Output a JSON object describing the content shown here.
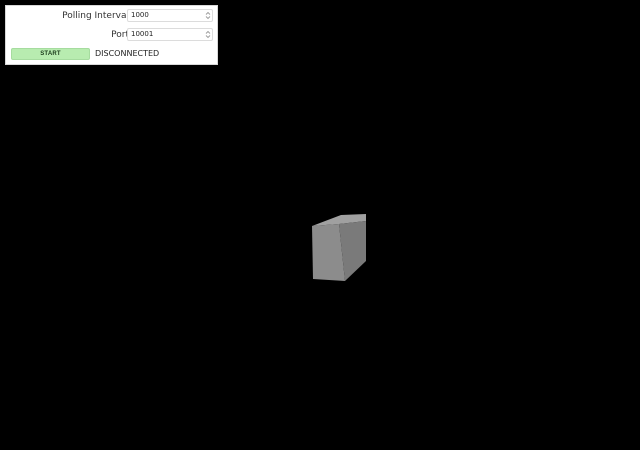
{
  "controls": {
    "polling_interval": {
      "label": "Polling Interval",
      "value": "1000"
    },
    "port": {
      "label": "Port",
      "value": "10001"
    },
    "start_button_label": "START",
    "status": "DISCONNECTED"
  },
  "colors": {
    "background": "#000000",
    "panel": "#ffffff",
    "start_button": "#b8ecb0",
    "cube_front": "#8a8a8a",
    "cube_top": "#a3a3a3",
    "cube_side": "#707070"
  },
  "icons": {
    "stepper": "up-down-chevron-icon",
    "object": "3d-box"
  }
}
